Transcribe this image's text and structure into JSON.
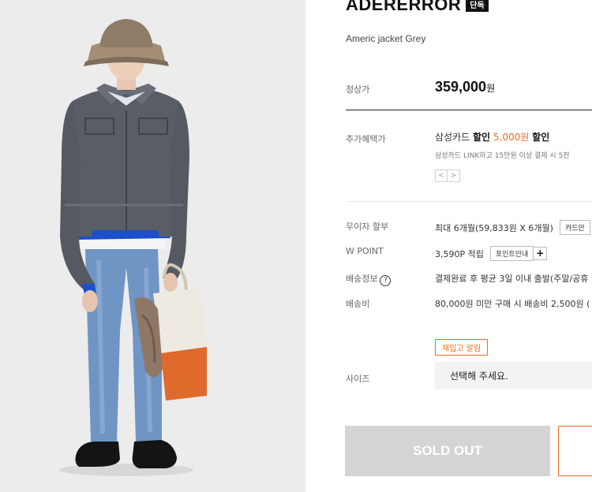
{
  "product": {
    "brand": "ADERERROR",
    "badge": "단독",
    "name": "Americ jacket Grey",
    "image_alt": "model wearing grey jacket, bucket hat, blue jeans, holding tote bag"
  },
  "price": {
    "label": "정상가",
    "amount": "359,000",
    "unit": "원"
  },
  "benefit": {
    "label": "추가혜택가",
    "card": "삼성카드",
    "discount_word": "할인",
    "discount_amount": "5,000원",
    "discount_suffix": "할인",
    "detail": "삼성카드 LINK하고 15만원 이상 결제 시 5천",
    "prev_arrow": "<",
    "next_arrow": ">"
  },
  "installment": {
    "label": "무이자 할부",
    "value": "최대 6개월(59,833원 X 6개월)",
    "button": "카드안"
  },
  "points": {
    "label": "W POINT",
    "value": "3,590P 적립",
    "button": "포인트안내",
    "plus": "+"
  },
  "shipping_info": {
    "label": "배송정보",
    "help": "?",
    "value": "결제완료 후 평균 3일 이내 출발(주말/공휴"
  },
  "shipping_fee": {
    "label": "배송비",
    "value": "80,000원 미만 구매 시 배송비 2,500원 ("
  },
  "restock": {
    "button": "재입고 알림"
  },
  "size": {
    "label": "사이즈",
    "placeholder": "선택해 주세요."
  },
  "actions": {
    "sold_out": "SOLD OUT"
  },
  "colors": {
    "accent": "#f26a1b",
    "sold_out_bg": "#d4d4d4",
    "photo_bg": "#ececec"
  }
}
